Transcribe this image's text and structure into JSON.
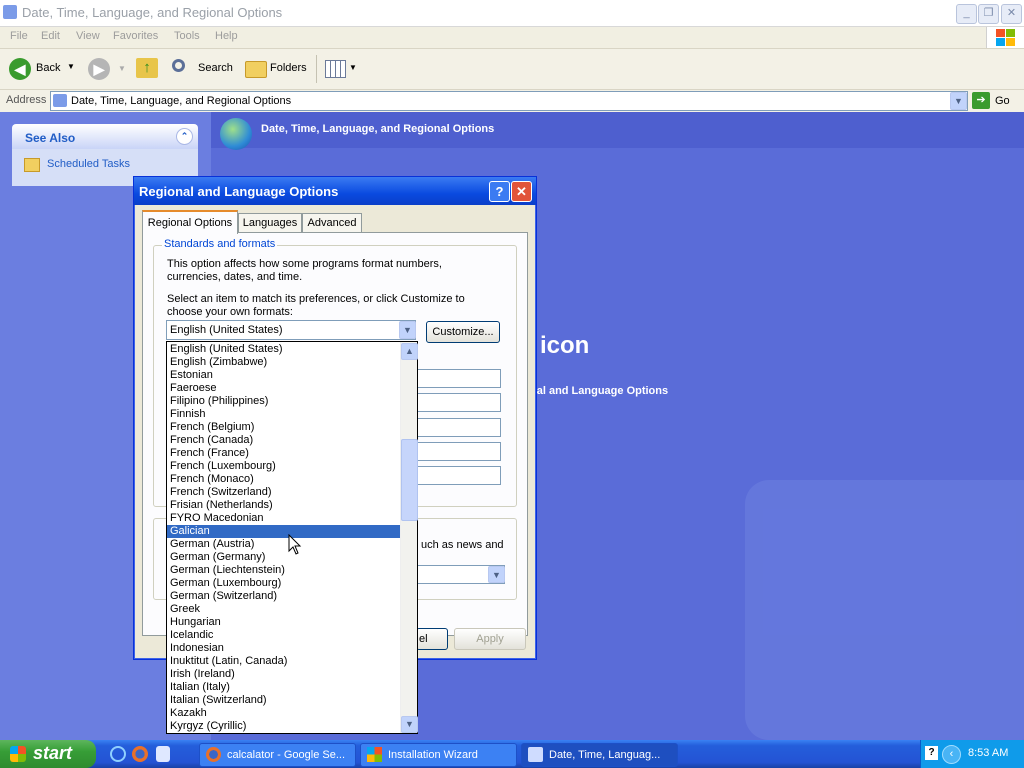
{
  "window": {
    "title": "Date, Time, Language, and Regional Options"
  },
  "menu": [
    "File",
    "Edit",
    "View",
    "Favorites",
    "Tools",
    "Help"
  ],
  "toolbar": {
    "back": "Back",
    "search": "Search",
    "folders": "Folders"
  },
  "address": {
    "label": "Address",
    "value": "Date, Time, Language, and Regional Options",
    "go": "Go"
  },
  "see_also": {
    "title": "See Also",
    "items": [
      "Scheduled Tasks"
    ]
  },
  "content": {
    "banner_title": "Date, Time, Language, and Regional Options",
    "partial_heading": "icon",
    "partial_link": "nal and Language Options"
  },
  "dialog": {
    "title": "Regional and Language Options",
    "tabs": [
      "Regional Options",
      "Languages",
      "Advanced"
    ],
    "group_standards": "Standards and formats",
    "desc1": "This option affects how some programs format numbers, currencies, dates, and time.",
    "desc2": "Select an item to match its preferences, or click Customize to choose your own formats:",
    "selected_format": "English (United States)",
    "customize": "Customize...",
    "partial_text": "uch as news and",
    "cancel_partial": "el",
    "apply": "Apply"
  },
  "dropdown": {
    "selected": "Galician",
    "options": [
      "English (United States)",
      "English (Zimbabwe)",
      "Estonian",
      "Faeroese",
      "Filipino (Philippines)",
      "Finnish",
      "French (Belgium)",
      "French (Canada)",
      "French (France)",
      "French (Luxembourg)",
      "French (Monaco)",
      "French (Switzerland)",
      "Frisian (Netherlands)",
      "FYRO Macedonian",
      "Galician",
      "German (Austria)",
      "German (Germany)",
      "German (Liechtenstein)",
      "German (Luxembourg)",
      "German (Switzerland)",
      "Greek",
      "Hungarian",
      "Icelandic",
      "Indonesian",
      "Inuktitut (Latin, Canada)",
      "Irish (Ireland)",
      "Italian (Italy)",
      "Italian (Switzerland)",
      "Kazakh",
      "Kyrgyz (Cyrillic)"
    ]
  },
  "taskbar": {
    "start": "start",
    "tasks": [
      "calcalator - Google Se...",
      "Installation Wizard",
      "Date, Time, Languag..."
    ],
    "clock": "8:53 AM"
  }
}
